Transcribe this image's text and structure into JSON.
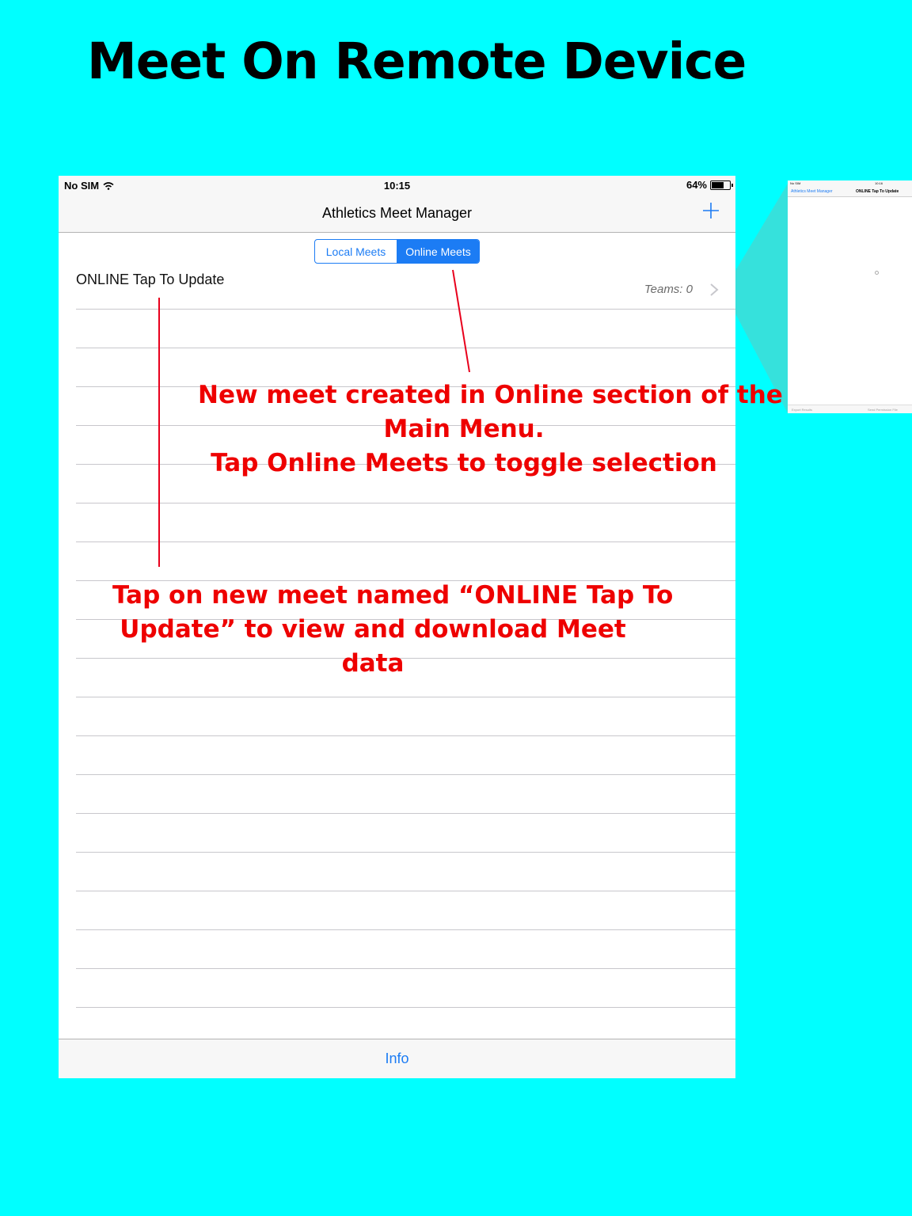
{
  "headline": "Meet On Remote Device",
  "status_bar": {
    "carrier": "No SIM",
    "time": "10:15",
    "battery": "64%",
    "battery_level": 0.64
  },
  "navbar": {
    "title": "Athletics Meet Manager",
    "add_icon": "plus-icon"
  },
  "segmented_control": {
    "items": [
      "Local Meets",
      "Online Meets"
    ],
    "selected": "Online Meets"
  },
  "meet_list": [
    {
      "name": "ONLINE Tap To Update",
      "teams": "Teams: 0"
    }
  ],
  "tab_bar": {
    "info_label": "Info"
  },
  "thumbnail": {
    "carrier": "No SIM",
    "time": "10:16",
    "back_label": "Athletics Meet Manager",
    "title": "ONLINE Tap To Update",
    "export_label": "Export Results",
    "send_label": "Send Permission File"
  },
  "annotations": {
    "online_section": [
      "New meet created in Online section of the",
      "Main Menu.",
      "Tap Online Meets to toggle selection"
    ],
    "tap_meet": [
      "Tap on new meet named “ONLINE Tap To",
      "Update” to view and download Meet",
      "data"
    ]
  },
  "colors": {
    "background": "#00ffff",
    "accent": "#1c7cf4",
    "annotation": "#ee0000"
  }
}
